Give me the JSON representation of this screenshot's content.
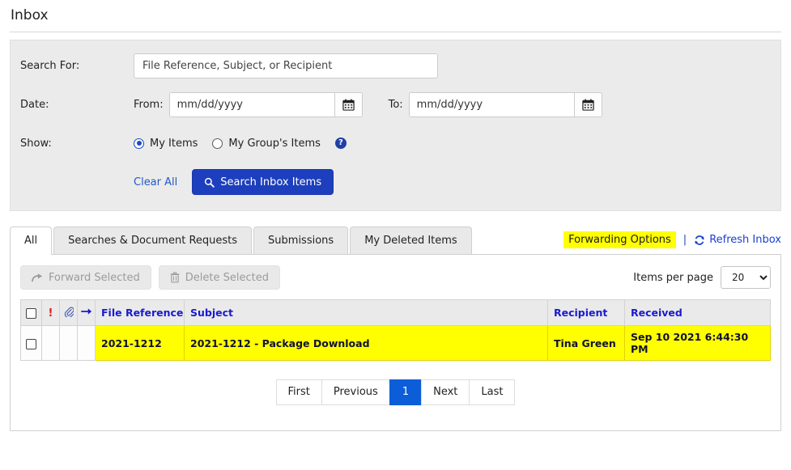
{
  "page": {
    "title": "Inbox"
  },
  "search": {
    "search_for_label": "Search For:",
    "search_placeholder": "File Reference, Subject, or Recipient",
    "search_value": "",
    "date_label": "Date:",
    "from_label": "From:",
    "to_label": "To:",
    "date_placeholder": "mm/dd/yyyy",
    "date_from_value": "",
    "date_to_value": "",
    "show_label": "Show:",
    "radio_my_items": "My Items",
    "radio_my_groups_items": "My Group's Items",
    "selected_show": "My Items",
    "help_icon": "help-circle-icon",
    "calendar_icon": "calendar-icon",
    "clear_all": "Clear All",
    "search_button": "Search Inbox Items",
    "search_icon": "magnifier-icon",
    "button_color": "#1d3fbe"
  },
  "tabs": {
    "items": [
      {
        "label": "All",
        "active": true
      },
      {
        "label": "Searches & Document Requests",
        "active": false
      },
      {
        "label": "Submissions",
        "active": false
      },
      {
        "label": "My Deleted Items",
        "active": false
      }
    ],
    "forwarding_options": "Forwarding Options",
    "forwarding_highlight_color": "#ffff00",
    "separator": "|",
    "refresh_inbox": "Refresh Inbox",
    "refresh_icon": "refresh-icon"
  },
  "toolbar": {
    "forward_selected": "Forward Selected",
    "forward_icon": "forward-arrow-icon",
    "delete_selected": "Delete Selected",
    "delete_icon": "trash-icon",
    "items_per_page_label": "Items per page",
    "items_per_page_value": "20",
    "items_per_page_options": [
      "20"
    ]
  },
  "grid": {
    "columns": [
      {
        "label": "",
        "name": "select-all"
      },
      {
        "label": "!",
        "name": "priority-icon"
      },
      {
        "label": "",
        "name": "attachment-icon"
      },
      {
        "label": "",
        "name": "forwarded-icon"
      },
      {
        "label": "File Reference",
        "name": "file-reference"
      },
      {
        "label": "Subject",
        "name": "subject"
      },
      {
        "label": "Recipient",
        "name": "recipient"
      },
      {
        "label": "Received",
        "name": "received"
      }
    ],
    "rows": [
      {
        "file_reference": "2021-1212",
        "subject": "2021-1212 - Package Download",
        "recipient": "Tina Green",
        "received": "Sep 10 2021 6:44:30 PM",
        "highlighted": true
      }
    ],
    "highlight_color": "#ffff00",
    "header_text_color": "#1a1ad0"
  },
  "pagination": {
    "first": "First",
    "previous": "Previous",
    "current_page": "1",
    "next": "Next",
    "last": "Last",
    "active_color": "#0b5ed7"
  }
}
